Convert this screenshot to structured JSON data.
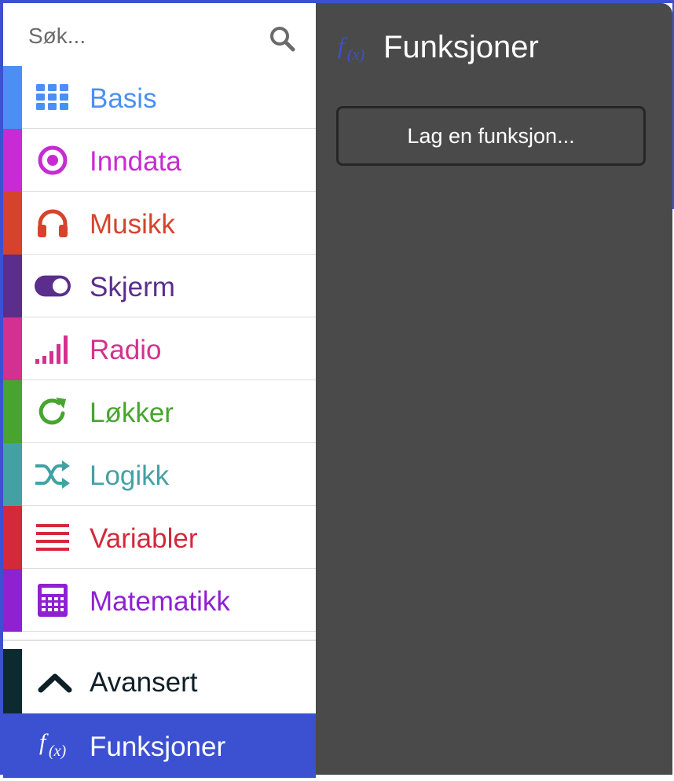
{
  "search": {
    "placeholder": "Søk...",
    "icon": "search-icon"
  },
  "categories": [
    {
      "label": "Basis",
      "color": "#4b8ff5",
      "icon": "grid-icon"
    },
    {
      "label": "Inndata",
      "color": "#c72bd3",
      "icon": "target-icon"
    },
    {
      "label": "Musikk",
      "color": "#d6432c",
      "icon": "headphones-icon"
    },
    {
      "label": "Skjerm",
      "color": "#5b2d8c",
      "icon": "toggle-icon"
    },
    {
      "label": "Radio",
      "color": "#d3318f",
      "icon": "signal-bars-icon"
    },
    {
      "label": "Løkker",
      "color": "#47a52f",
      "icon": "refresh-icon"
    },
    {
      "label": "Logikk",
      "color": "#43a1a4",
      "icon": "shuffle-icon"
    },
    {
      "label": "Variabler",
      "color": "#d3293a",
      "icon": "list-lines-icon"
    },
    {
      "label": "Matematikk",
      "color": "#8f21d1",
      "icon": "calculator-icon"
    }
  ],
  "advanced": {
    "label": "Avansert",
    "color": "#0e2a31",
    "icon": "chevron-up-icon"
  },
  "functions": {
    "label": "Funksjoner",
    "color": "#3c50d2",
    "icon": "function-icon"
  },
  "flyout": {
    "title": "Funksjoner",
    "background": "#4b4a4b",
    "button_label": "Lag en funksjon..."
  }
}
